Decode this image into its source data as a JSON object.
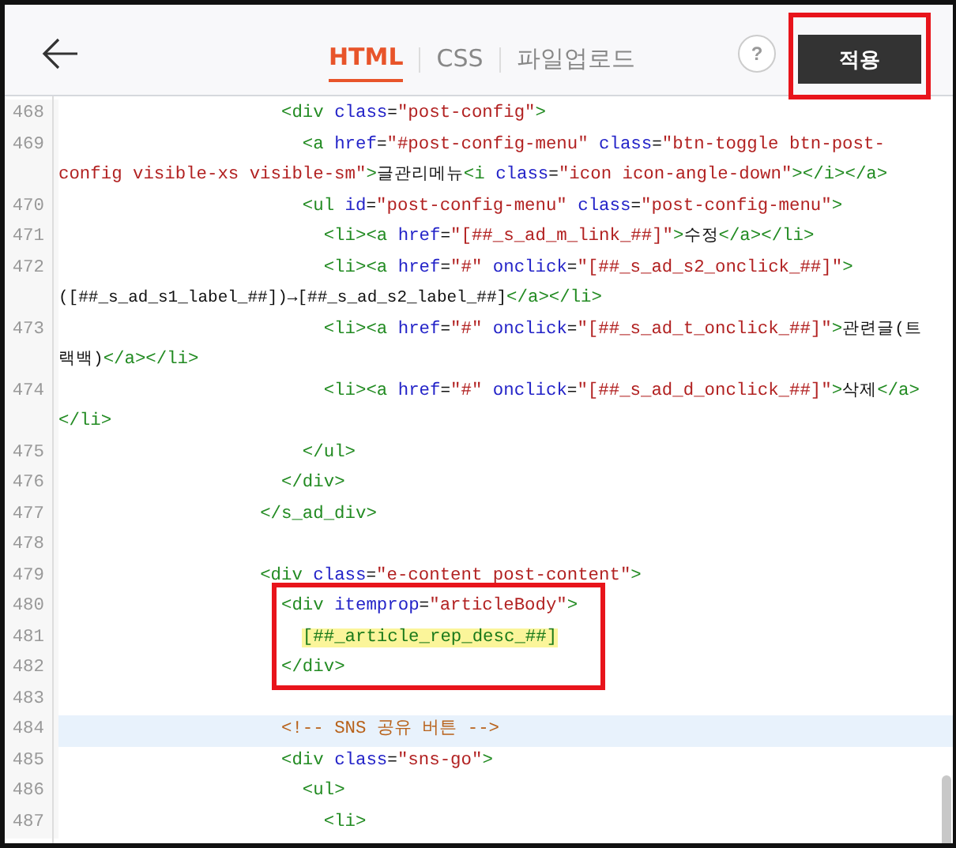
{
  "header": {
    "tabs": [
      {
        "label": "HTML",
        "selected": true
      },
      {
        "label": "CSS",
        "selected": false
      },
      {
        "label": "파일업로드",
        "selected": false
      }
    ],
    "help": "?",
    "apply_button": {
      "label": "적용",
      "outlined": true
    }
  },
  "editor": {
    "lines": [
      {
        "number": "468",
        "active": false,
        "rows": [
          {
            "tokens": [
              {
                "kind": "tag",
                "text": "                     <div"
              },
              {
                "kind": "attr",
                "text": " class"
              },
              {
                "kind": "text",
                "text": "="
              },
              {
                "kind": "value",
                "text": "\"post-config\""
              },
              {
                "kind": "tag",
                "text": ">"
              }
            ]
          }
        ]
      },
      {
        "number": "469",
        "active": false,
        "rows": [
          {
            "tokens": [
              {
                "kind": "tag",
                "text": "                       <a"
              },
              {
                "kind": "attr",
                "text": " href"
              },
              {
                "kind": "text",
                "text": "="
              },
              {
                "kind": "value",
                "text": "\"#post-config-menu\""
              },
              {
                "kind": "attr",
                "text": " class"
              },
              {
                "kind": "text",
                "text": "="
              },
              {
                "kind": "value",
                "text": "\"btn-toggle btn-post-"
              }
            ]
          },
          {
            "tokens": [
              {
                "kind": "value",
                "text": "config visible-xs visible-sm\""
              },
              {
                "kind": "tag",
                "text": ">"
              },
              {
                "kind": "text",
                "text": "글관리메뉴"
              },
              {
                "kind": "tag",
                "text": "<i"
              },
              {
                "kind": "attr",
                "text": " class"
              },
              {
                "kind": "text",
                "text": "="
              },
              {
                "kind": "value",
                "text": "\"icon icon-angle-down\""
              },
              {
                "kind": "tag",
                "text": "></i></a>"
              }
            ]
          }
        ]
      },
      {
        "number": "470",
        "active": false,
        "rows": [
          {
            "tokens": [
              {
                "kind": "tag",
                "text": "                       <ul"
              },
              {
                "kind": "attr",
                "text": " id"
              },
              {
                "kind": "text",
                "text": "="
              },
              {
                "kind": "value",
                "text": "\"post-config-menu\""
              },
              {
                "kind": "attr",
                "text": " class"
              },
              {
                "kind": "text",
                "text": "="
              },
              {
                "kind": "value",
                "text": "\"post-config-menu\""
              },
              {
                "kind": "tag",
                "text": ">"
              }
            ]
          }
        ]
      },
      {
        "number": "471",
        "active": false,
        "rows": [
          {
            "tokens": [
              {
                "kind": "tag",
                "text": "                         <li><a"
              },
              {
                "kind": "attr",
                "text": " href"
              },
              {
                "kind": "text",
                "text": "="
              },
              {
                "kind": "value",
                "text": "\"[##_s_ad_m_link_##]\""
              },
              {
                "kind": "tag",
                "text": ">"
              },
              {
                "kind": "text",
                "text": "수정"
              },
              {
                "kind": "tag",
                "text": "</a></li>"
              }
            ]
          }
        ]
      },
      {
        "number": "472",
        "active": false,
        "rows": [
          {
            "tokens": [
              {
                "kind": "tag",
                "text": "                         <li><a"
              },
              {
                "kind": "attr",
                "text": " href"
              },
              {
                "kind": "text",
                "text": "="
              },
              {
                "kind": "value",
                "text": "\"#\""
              },
              {
                "kind": "attr",
                "text": " onclick"
              },
              {
                "kind": "text",
                "text": "="
              },
              {
                "kind": "value",
                "text": "\"[##_s_ad_s2_onclick_##]\""
              },
              {
                "kind": "tag",
                "text": ">"
              }
            ]
          },
          {
            "tokens": [
              {
                "kind": "text",
                "text": "([##_s_ad_s1_label_##])→[##_s_ad_s2_label_##]"
              },
              {
                "kind": "tag",
                "text": "</a></li>"
              }
            ]
          }
        ]
      },
      {
        "number": "473",
        "active": false,
        "rows": [
          {
            "tokens": [
              {
                "kind": "tag",
                "text": "                         <li><a"
              },
              {
                "kind": "attr",
                "text": " href"
              },
              {
                "kind": "text",
                "text": "="
              },
              {
                "kind": "value",
                "text": "\"#\""
              },
              {
                "kind": "attr",
                "text": " onclick"
              },
              {
                "kind": "text",
                "text": "="
              },
              {
                "kind": "value",
                "text": "\"[##_s_ad_t_onclick_##]\""
              },
              {
                "kind": "tag",
                "text": ">"
              },
              {
                "kind": "text",
                "text": "관련글(트"
              }
            ]
          },
          {
            "tokens": [
              {
                "kind": "text",
                "text": "랙백)"
              },
              {
                "kind": "tag",
                "text": "</a></li>"
              }
            ]
          }
        ]
      },
      {
        "number": "474",
        "active": false,
        "rows": [
          {
            "tokens": [
              {
                "kind": "tag",
                "text": "                         <li><a"
              },
              {
                "kind": "attr",
                "text": " href"
              },
              {
                "kind": "text",
                "text": "="
              },
              {
                "kind": "value",
                "text": "\"#\""
              },
              {
                "kind": "attr",
                "text": " onclick"
              },
              {
                "kind": "text",
                "text": "="
              },
              {
                "kind": "value",
                "text": "\"[##_s_ad_d_onclick_##]\""
              },
              {
                "kind": "tag",
                "text": ">"
              },
              {
                "kind": "text",
                "text": "삭제"
              },
              {
                "kind": "tag",
                "text": "</a>"
              }
            ]
          },
          {
            "tokens": [
              {
                "kind": "tag",
                "text": "</li>"
              }
            ]
          }
        ]
      },
      {
        "number": "475",
        "active": false,
        "rows": [
          {
            "tokens": [
              {
                "kind": "tag",
                "text": "                       </ul>"
              }
            ]
          }
        ]
      },
      {
        "number": "476",
        "active": false,
        "rows": [
          {
            "tokens": [
              {
                "kind": "tag",
                "text": "                     </div>"
              }
            ]
          }
        ]
      },
      {
        "number": "477",
        "active": false,
        "rows": [
          {
            "tokens": [
              {
                "kind": "tag",
                "text": "                   </s_ad_div>"
              }
            ]
          }
        ]
      },
      {
        "number": "478",
        "active": false
      },
      {
        "number": "479",
        "active": false,
        "rows": [
          {
            "tokens": [
              {
                "kind": "tag",
                "text": "                   <div"
              },
              {
                "kind": "attr",
                "text": " class"
              },
              {
                "kind": "text",
                "text": "="
              },
              {
                "kind": "value",
                "text": "\"e-content post-content\""
              },
              {
                "kind": "tag",
                "text": ">"
              }
            ]
          }
        ]
      },
      {
        "number": "480",
        "active": false,
        "rows": [
          {
            "tokens": [
              {
                "kind": "tag",
                "text": "                     <div"
              },
              {
                "kind": "attr",
                "text": " itemprop"
              },
              {
                "kind": "text",
                "text": "="
              },
              {
                "kind": "value",
                "text": "\"articleBody\""
              },
              {
                "kind": "tag",
                "text": ">"
              }
            ]
          }
        ]
      },
      {
        "number": "481",
        "active": false,
        "rows": [
          {
            "tokens": [
              {
                "kind": "match",
                "text": "                       [##_article_rep_desc_##]"
              }
            ]
          }
        ]
      },
      {
        "number": "482",
        "active": false,
        "rows": [
          {
            "tokens": [
              {
                "kind": "tag",
                "text": "                     </div>"
              }
            ]
          }
        ]
      },
      {
        "number": "483",
        "active": false
      },
      {
        "number": "484",
        "active": true,
        "rows": [
          {
            "tokens": [
              {
                "kind": "comment",
                "text": "                     <!-- SNS 공유 버튼 -->"
              }
            ]
          }
        ]
      },
      {
        "number": "485",
        "active": false,
        "rows": [
          {
            "tokens": [
              {
                "kind": "tag",
                "text": "                     <div"
              },
              {
                "kind": "attr",
                "text": " class"
              },
              {
                "kind": "text",
                "text": "="
              },
              {
                "kind": "value",
                "text": "\"sns-go\""
              },
              {
                "kind": "tag",
                "text": ">"
              }
            ]
          }
        ]
      },
      {
        "number": "486",
        "active": false,
        "rows": [
          {
            "tokens": [
              {
                "kind": "tag",
                "text": "                       <ul>"
              }
            ]
          }
        ]
      },
      {
        "number": "487",
        "active": false,
        "rows": [
          {
            "tokens": [
              {
                "kind": "tag",
                "text": "                         <li>"
              }
            ]
          }
        ]
      }
    ]
  }
}
